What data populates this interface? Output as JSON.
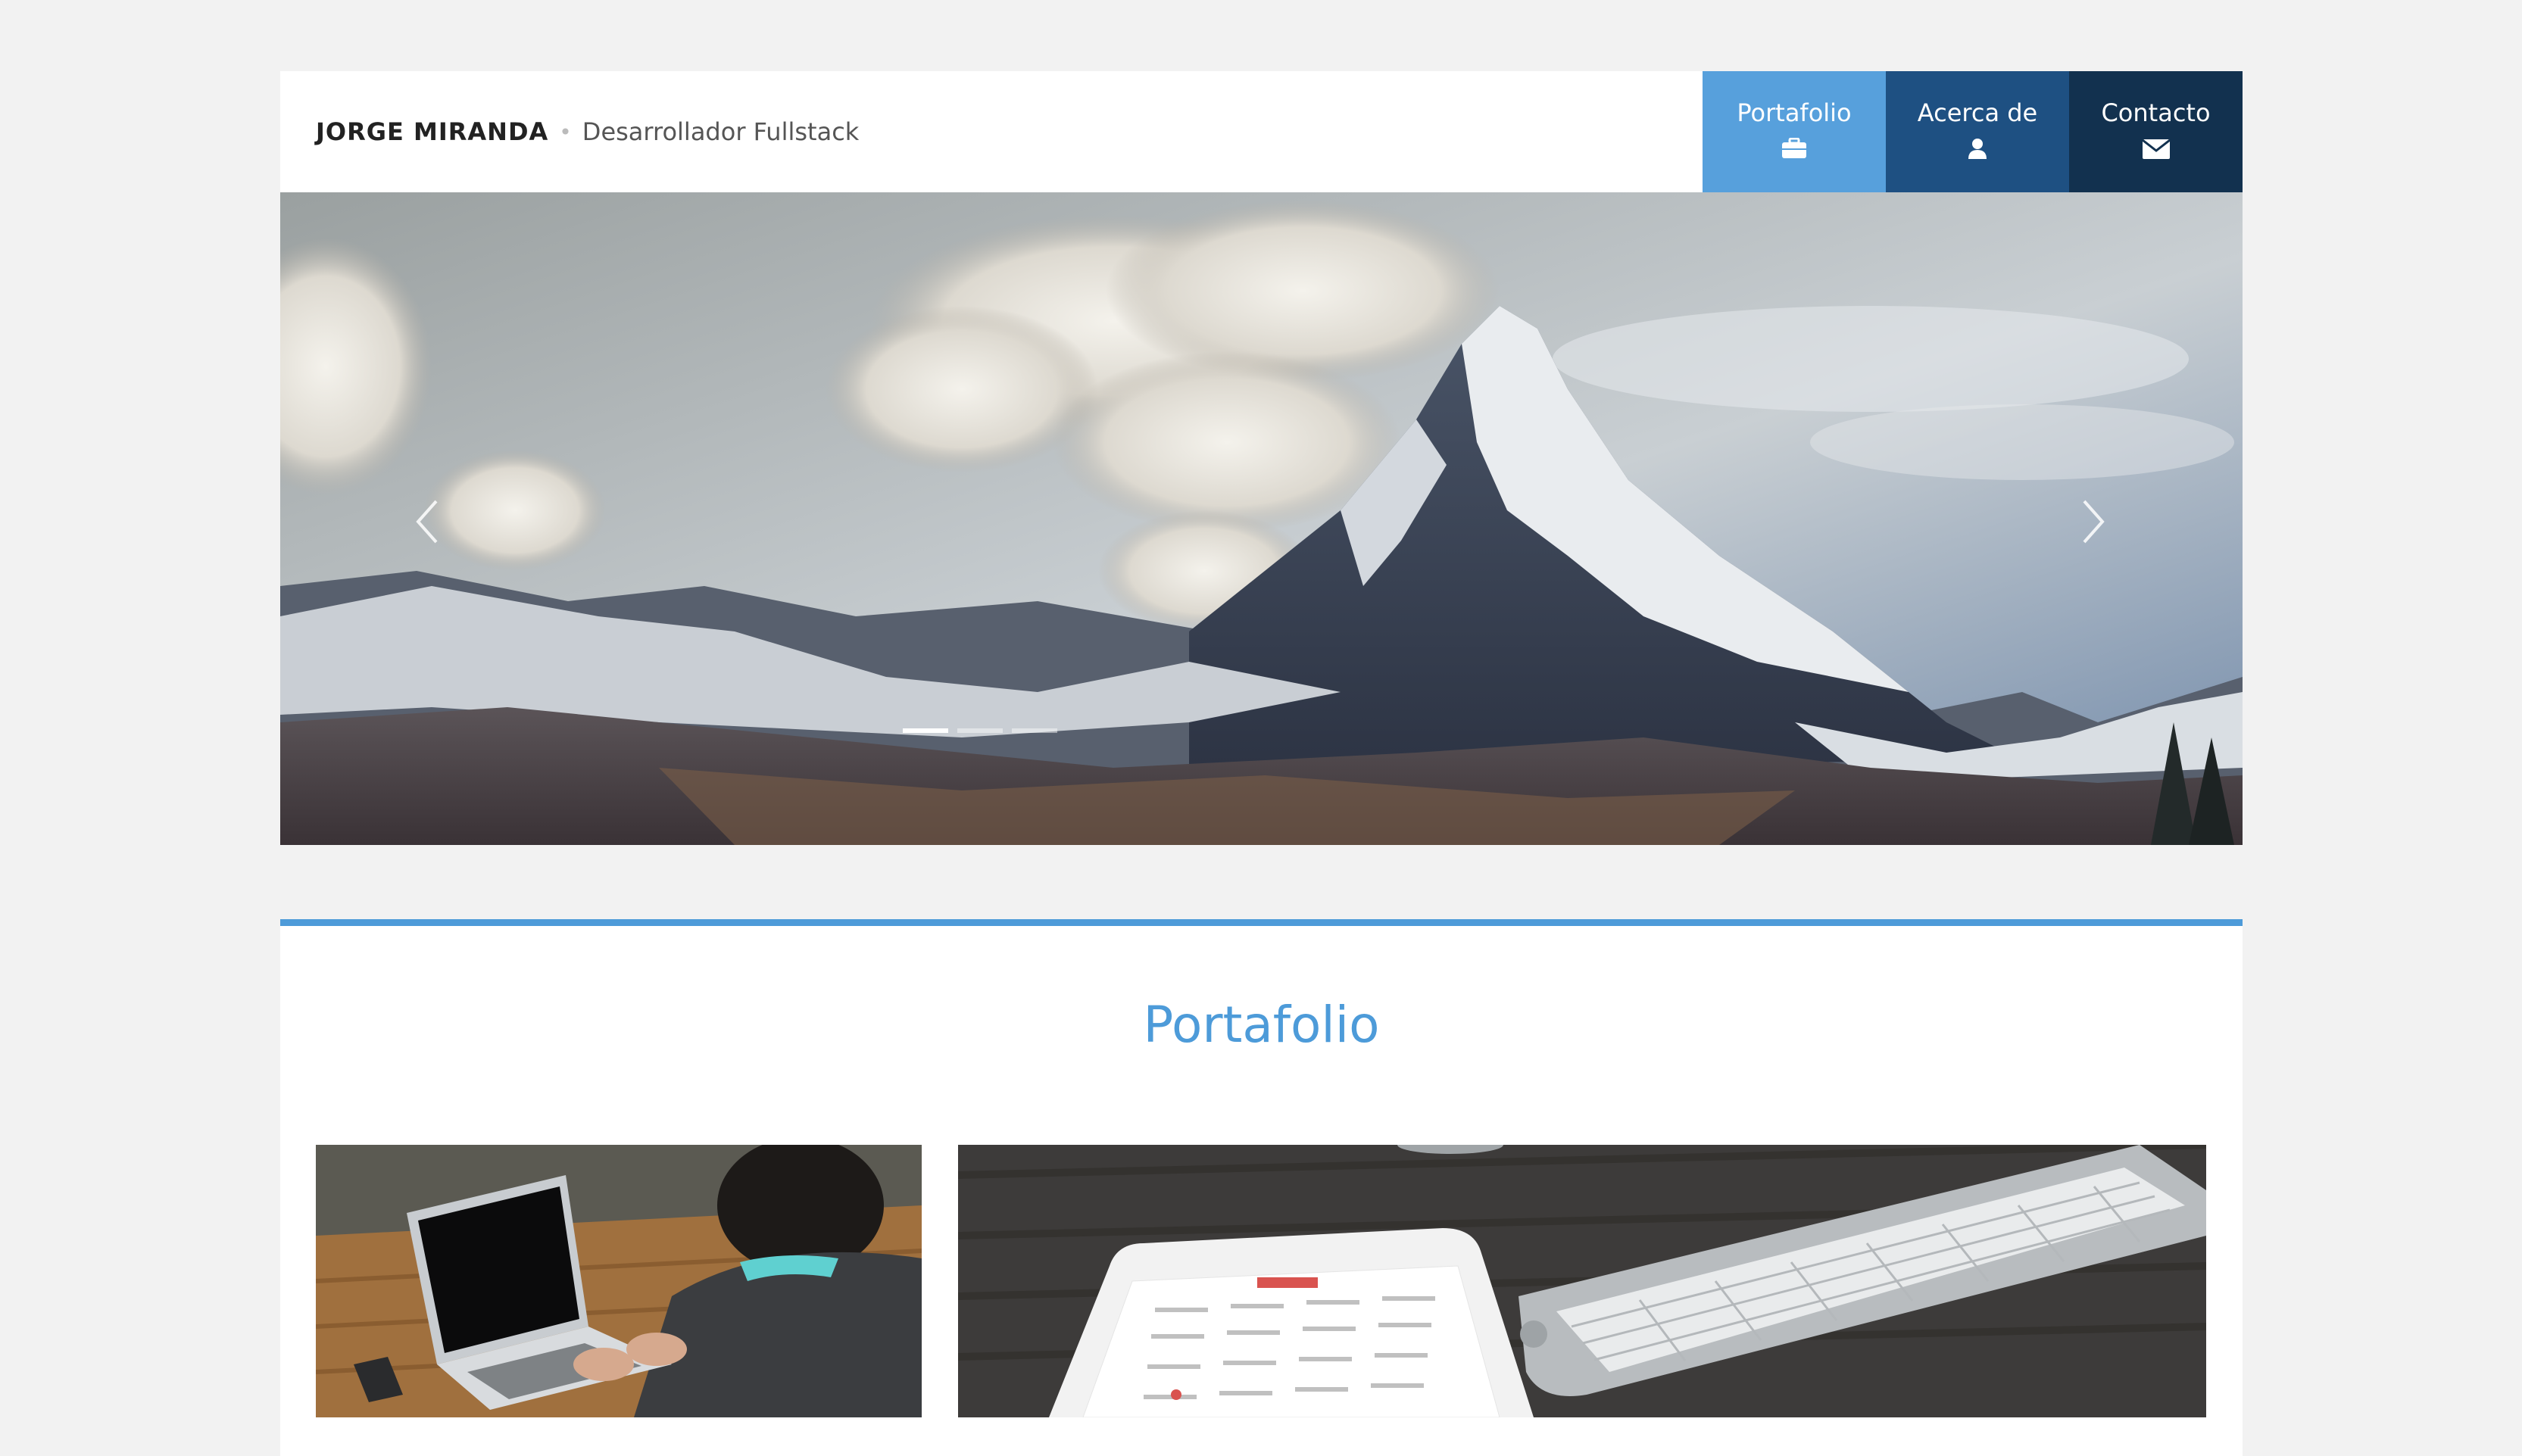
{
  "header": {
    "name": "JORGE MIRANDA",
    "separator": "•",
    "role": "Desarrollador Fullstack"
  },
  "nav": [
    {
      "label": "Portafolio",
      "icon": "briefcase-icon",
      "color": "#57a0dc"
    },
    {
      "label": "Acerca de",
      "icon": "user-icon",
      "color": "#1e5082"
    },
    {
      "label": "Contacto",
      "icon": "envelope-icon",
      "color": "#12314f"
    }
  ],
  "carousel": {
    "image": "mountain-peak-photo",
    "indicator_count": 3,
    "active_indicator": 1
  },
  "portfolio": {
    "title": "Portafolio",
    "accent_color": "#4d9bd9",
    "items": [
      {
        "image": "laptop-on-desk-photo"
      },
      {
        "image": "tablet-and-keyboard-photo"
      }
    ]
  }
}
